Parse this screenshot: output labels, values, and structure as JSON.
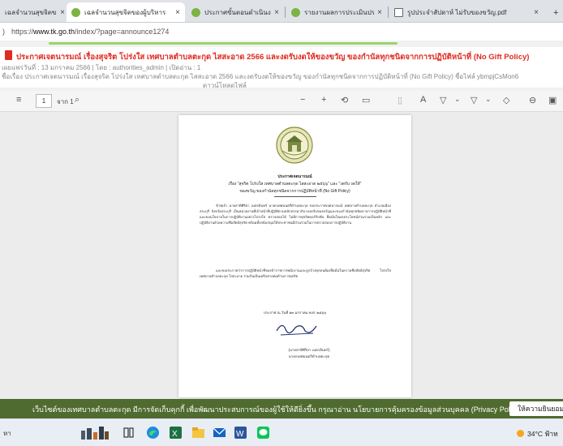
{
  "browser": {
    "tabs": [
      {
        "label": "เฉลจำนวนสุขจิตของผู้บริหาร",
        "color": "#7cb342",
        "active": false
      },
      {
        "label": "เฉลจำนวนสุขจิตของผู้บริหาร",
        "color": "#7cb342",
        "active": true
      },
      {
        "label": "ประกาศขั้นตอนดำเนินงาน ประจำปีงบประ",
        "color": "#7cb342",
        "active": false
      },
      {
        "label": "รายงานผลการประเมินประจำสัปดาห์ที่",
        "color": "#7cb342",
        "active": false
      },
      {
        "label": "รูปประจำสัปดาห์ ไม่รับของขวัญ.pdf",
        "color": "#ffffff",
        "active": false
      }
    ],
    "close_glyph": "×",
    "add_tab_glyph": "+",
    "url_prefix": "https://",
    "url_host": "www.tk.go.th",
    "url_path": "/index/?page=announce1274",
    "nav_fragment": ")"
  },
  "page": {
    "title": "ประกาศเจตนารมณ์ เรื่องสุจริต โปร่งใส เทศบาลตำบลตะกุด ไสสะอาด 2566 และงดรับงดให้ของขวัญ ของกำนัลทุกชนิดจากการปฏิบัติหน้าที่ (No Gift Policy)",
    "meta": "เผยแพร่วันที่ : 13 มกราคม 2566 | โดย : authorities_admin | เปิดอ่าน : 1",
    "desc": "ชื่อเรื่อง ประกาศเจตนารมณ์ เรื่องสุจริต โปร่งใส เทศบาลตำบลตะกุด ไสสะอาด 2566 และงดรับงดให้ของขวัญ ของกำนัลทุกชนิดจากการปฏิบัติหน้าที่ (No Gift Policy)    ชื่อไฟล์ ybmpjCsMon6",
    "desc2": "ดาวน์โหลดไฟล์"
  },
  "pdf_toolbar": {
    "menu_icon": "≡",
    "page_value": "1",
    "page_count": "จาก 1",
    "search_icon": "⌕",
    "zoom_out": "−",
    "zoom_in": "+",
    "tools": [
      "⟲",
      "▭",
      "▯",
      "A",
      "▽",
      "⌄",
      "▽",
      "⌄",
      "◇",
      "⊖",
      "▣"
    ]
  },
  "pdf_page": {
    "heading1": "ประกาศเจตนารมณ์",
    "heading2": "เรื่อง \"สุจริต โปร่งใส เทศบาลตำบลตะกุด ไสสะอาด ๒๕๖๖\" และ \"งดรับ งดให้\"",
    "heading3": "ของขวัญ ของกำนัลทุกชนิดจากการปฏิบัติหน้าที่ (No Gift Policy)",
    "para1": "ข้าพเจ้า นายสาทิพีริยา เนตรอินทร์ นายกเทศมนตรีตำบลตะกุด ขอประกาศเจตนารมณ์ เทศบาลตำบลตะกุด อำเภอเมืองสระบุรี จังหวัดสระบุรี เป็นหน่วยงานที่เจ้าหน้าที่ปฏิบัติตามหลักธรรมาภิบาลงดรับของขวัญและของกำนัลทุกชนิดจากการปฏิบัติหน้าที่ และขอนโยบายในการปฏิบัติงานอย่างโปร่งใส ตรวจสอบได้ ไม่มีการทุจริตคอร์รัปชัน ยึดมั่นในผลประโยชน์ส่วนรวมเป็นหลัก และปฏิบัติงานด้วยความซื่อสัตย์สุจริต พร้อมทั้งสนับสนุนให้ประชาชนมีส่วนร่วมในการตรวจสอบการปฏิบัติงาน",
    "para2": "และขอประกาศว่าการปฏิบัติหน้าที่ของข้าราชการพนักงานและลูกจ้างทุกคนต้องยึดมั่นในความซื่อสัตย์สุจริต โปร่งใส เทศบาลตำบลตะกุด ไสสะอาด ร่วมกันเป็นเครือข่ายต่อต้านการทุจริต",
    "date": "ประกาศ ณ วันที่ ๑๓ มกราคม พ.ศ. ๒๕๖๖",
    "signer_name": "(นายสาทิพีริยา เนตรอินทร์)",
    "signer_title": "นายกเทศมนตรีตำบลตะกุด"
  },
  "cookie": {
    "text": "เว็บไซต์ของเทศบาลตำบลตะกุด มีการจัดเก็บคุกกี้ เพื่อพัฒนาประสบการณ์ของผู้ใช้ให้ดียิ่งขึ้น กรุณาอ่าน นโยบายการคุ้มครองข้อมูลส่วนบุคคล (Privacy Policy)",
    "button": "ให้ความยินยอม"
  },
  "taskbar": {
    "search_fragment": "หา",
    "weather": "34°C ฟ้าห"
  }
}
